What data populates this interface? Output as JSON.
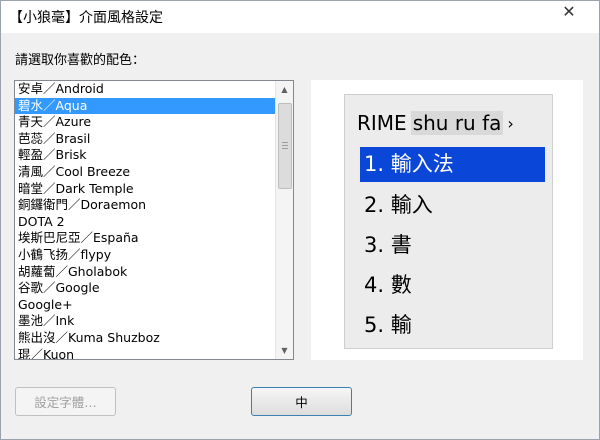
{
  "window": {
    "title": "【小狼毫】介面風格設定",
    "close_glyph": "✕"
  },
  "prompt": "請選取你喜歡的配色：",
  "list": {
    "items": [
      "安卓／Android",
      "碧水／Aqua",
      "青天／Azure",
      "芭蕊／Brasil",
      "輕盈／Brisk",
      "清風／Cool Breeze",
      "暗堂／Dark Temple",
      "銅鑼衛門／Doraemon",
      "DOTA 2",
      "埃斯巴尼亞／España",
      "小鶴飞扬／flypy",
      "胡蘿蔔／Gholabok",
      "谷歌／Google",
      "Google+",
      "墨池／Ink",
      "熊出沒／Kuma Shuzboz",
      "琨／Kuon"
    ],
    "selected_index": 1
  },
  "preview": {
    "prefix": "RIME",
    "preedit": "shu ru fa",
    "more_glyph": "›",
    "candidates": [
      "1. 輸入法",
      "2. 輸入",
      "3. 書",
      "4. 數",
      "5. 輸"
    ],
    "highlighted_index": 0
  },
  "buttons": {
    "font": "設定字體…",
    "ok": "中"
  },
  "icons": {
    "scroll_up": "up-arrow-icon",
    "scroll_down": "down-arrow-icon",
    "close": "close-icon"
  }
}
